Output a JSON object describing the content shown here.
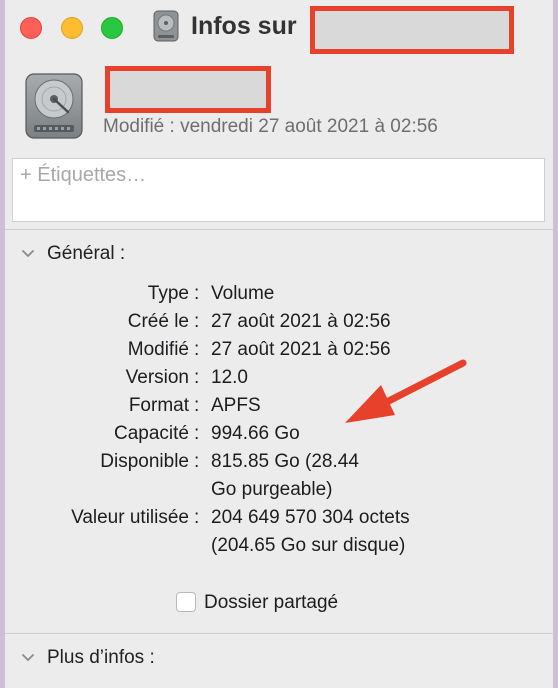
{
  "window": {
    "title_prefix": "Infos sur",
    "title_name_redacted": true
  },
  "header": {
    "name_redacted": true,
    "modified_line": "Modifié : vendredi 27 août 2021 à 02:56",
    "tags_placeholder": "+ Étiquettes…"
  },
  "general": {
    "section_label": "Général :",
    "rows": [
      {
        "label": "Type",
        "value": "Volume"
      },
      {
        "label": "Créé le",
        "value": "27 août 2021 à 02:56"
      },
      {
        "label": "Modifié",
        "value": "27 août 2021 à 02:56"
      },
      {
        "label": "Version",
        "value": "12.0"
      },
      {
        "label": "Format",
        "value": "APFS"
      },
      {
        "label": "Capacité",
        "value": "994.66 Go"
      },
      {
        "label": "Disponible",
        "value": "815.85 Go (28.44",
        "value_line2": "Go purgeable)"
      },
      {
        "label": "Valeur utilisée",
        "value": "204 649 570 304 octets",
        "value_line2": "(204.65 Go sur disque)"
      }
    ],
    "shared_folder_label": "Dossier partagé",
    "shared_folder_checked": false
  },
  "more_info": {
    "section_label": "Plus d’infos :"
  },
  "colors": {
    "annotation_arrow": "#e8412b",
    "redaction_border": "#e8412b",
    "close": "#fe5f57",
    "minimize": "#febc2e",
    "zoom": "#28c840"
  },
  "icons": {
    "disk": "hard-drive-icon",
    "chevron": "chevron-down-icon"
  }
}
